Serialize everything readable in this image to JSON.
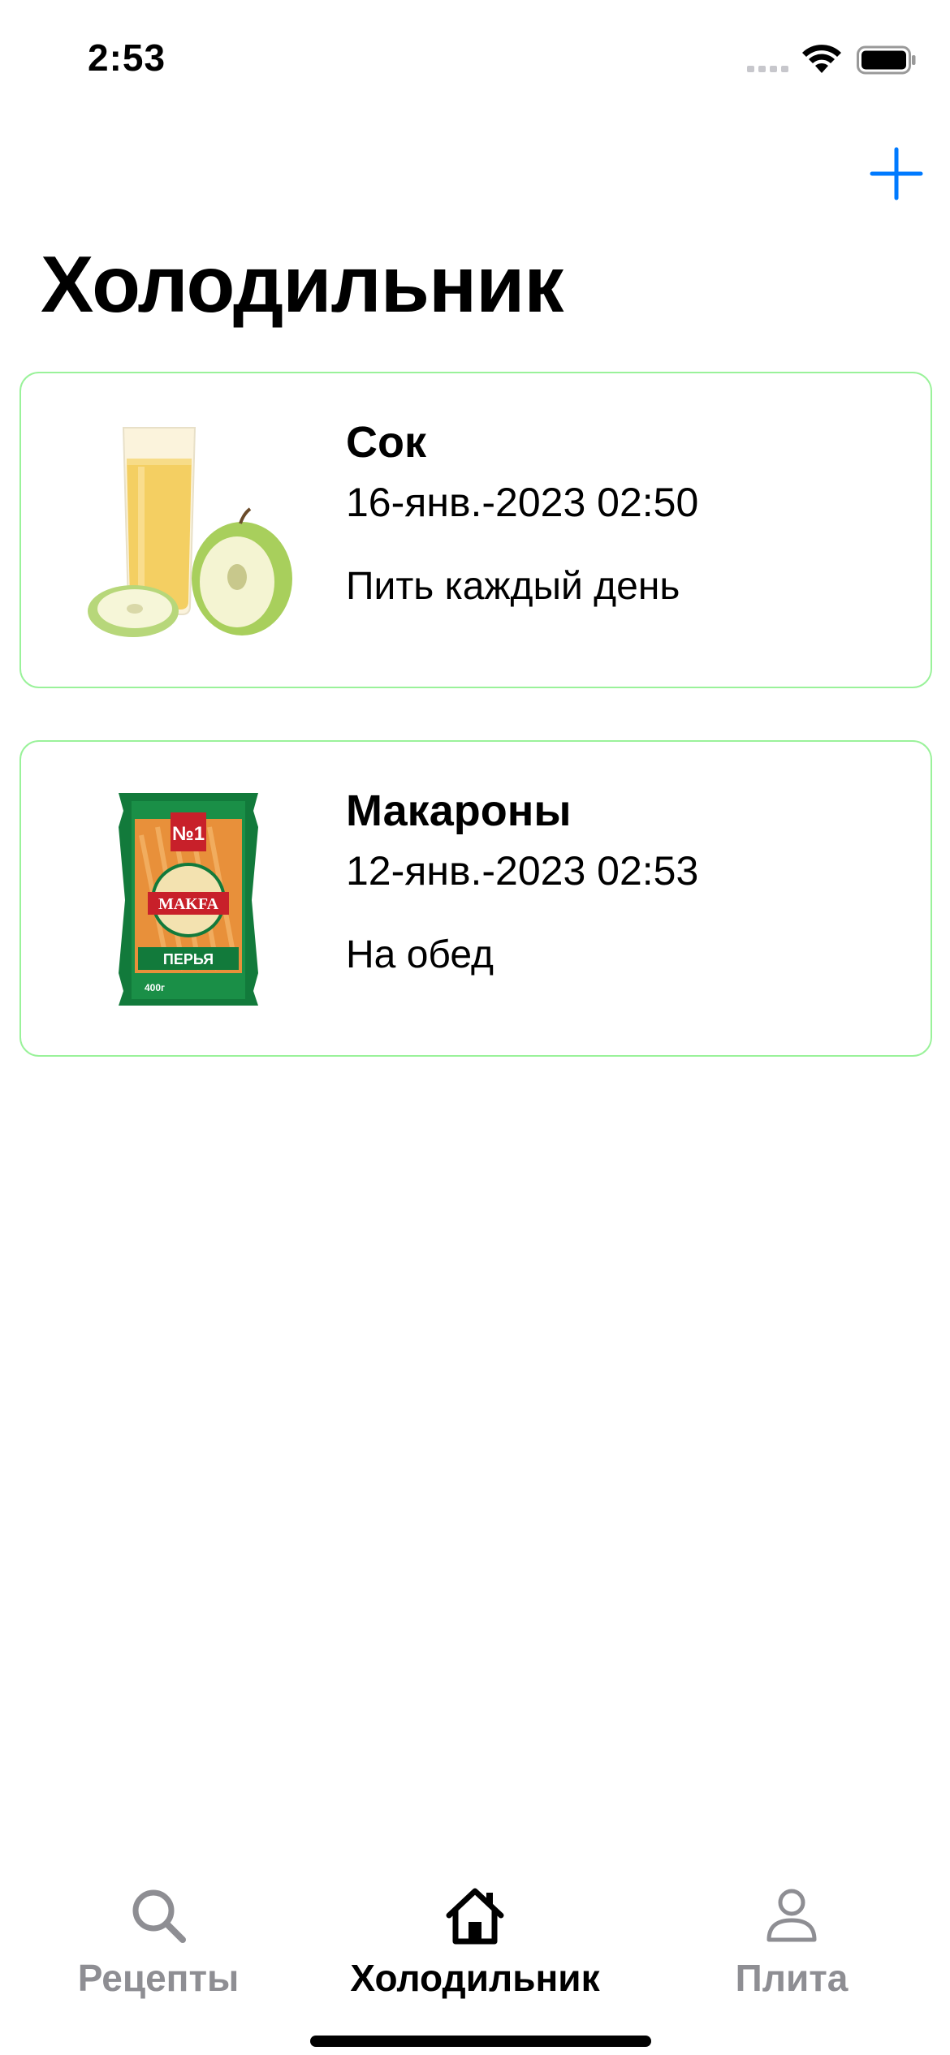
{
  "status_bar": {
    "time": "2:53"
  },
  "nav": {
    "add_icon": "plus-icon",
    "title": "Холодильник"
  },
  "items": [
    {
      "title": "Сок",
      "date": "16-янв.-2023 02:50",
      "note": "Пить каждый день",
      "image": "juice-with-apples"
    },
    {
      "title": "Макароны",
      "date": "12-янв.-2023 02:53",
      "note": "На обед",
      "image": "pasta-package",
      "package_text": {
        "top": "№1",
        "brand": "MAKFA",
        "kind": "ПЕРЬЯ",
        "weight": "400г"
      }
    }
  ],
  "tab_bar": {
    "tabs": [
      {
        "label": "Рецепты",
        "icon": "search-icon",
        "active": false
      },
      {
        "label": "Холодильник",
        "icon": "house-icon",
        "active": true
      },
      {
        "label": "Плита",
        "icon": "person-icon",
        "active": false
      }
    ]
  },
  "colors": {
    "accent": "#007aff",
    "card_border": "#9af29a",
    "tab_inactive": "#8e8e93",
    "tab_active": "#000000"
  }
}
